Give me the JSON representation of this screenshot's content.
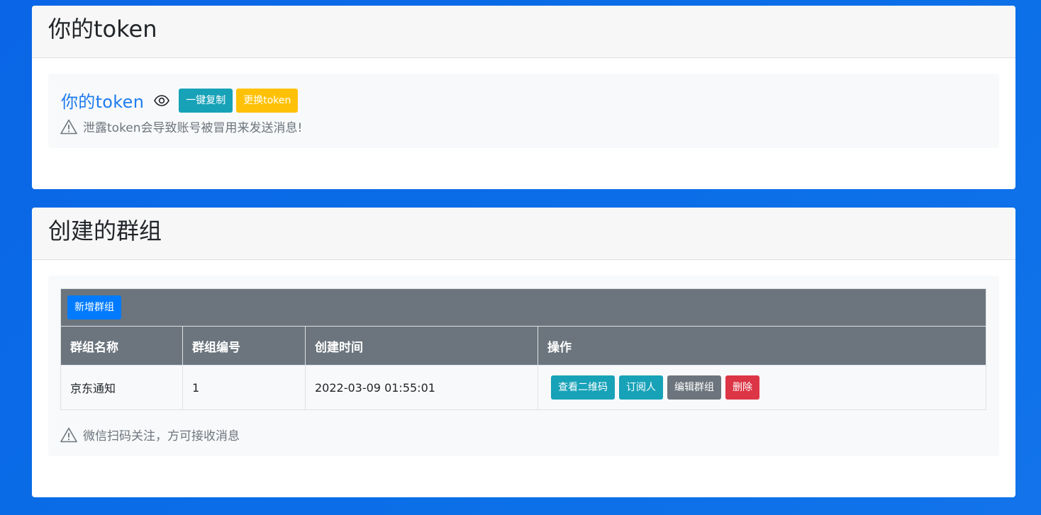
{
  "token_card": {
    "title": "你的token",
    "label": "你的token",
    "copy_button": "一键复制",
    "change_button": "更换token",
    "warning": "泄露token会导致账号被冒用来发送消息!"
  },
  "groups_card": {
    "title": "创建的群组",
    "add_button": "新增群组",
    "columns": [
      "群组名称",
      "群组编号",
      "创建时间",
      "操作"
    ],
    "rows": [
      {
        "name": "京东通知",
        "id": "1",
        "created": "2022-03-09 01:55:01",
        "actions": [
          "查看二维码",
          "订阅人",
          "编辑群组",
          "删除"
        ]
      }
    ],
    "warning": "微信扫码关注，方可接收消息"
  },
  "icons": {
    "eye": "eye-icon",
    "warning": "warning-triangle-icon"
  },
  "colors": {
    "background": "#0a66e6",
    "info": "#17a2b8",
    "warning": "#ffc107",
    "primary": "#007bff",
    "secondary": "#6c757d",
    "danger": "#dc3545",
    "token_label": "#1e7cf0"
  }
}
